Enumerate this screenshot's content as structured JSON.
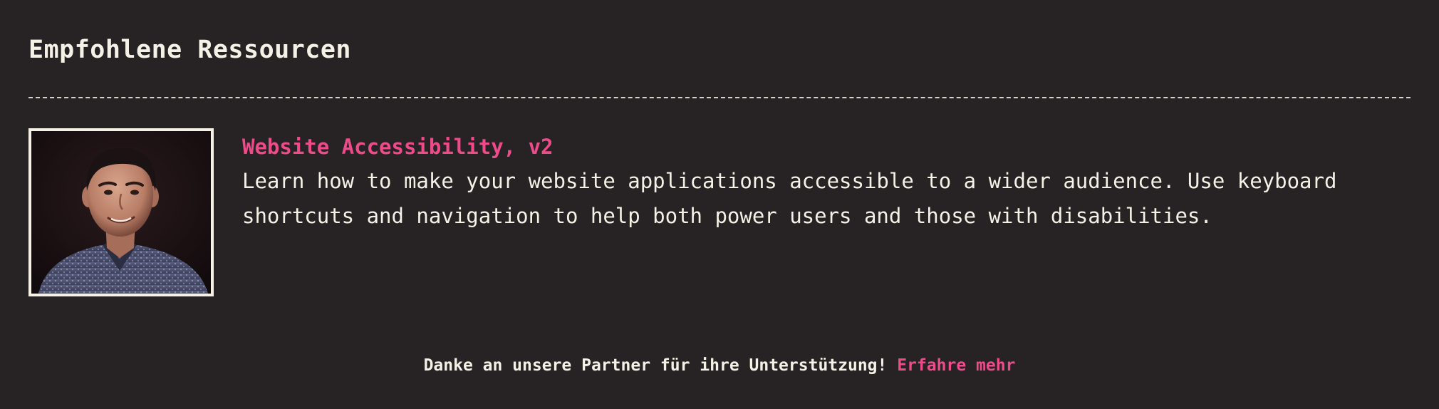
{
  "section": {
    "title": "Empfohlene Ressourcen"
  },
  "resource": {
    "title": "Website Accessibility, v2",
    "description": "Learn how to make your website applications accessible to a wider audience. Use keyboard shortcuts and navigation to help both power users and those with disabilities.",
    "image": "instructor-portrait"
  },
  "footer": {
    "thanks_text": "Danke an unsere Partner für ihre Unterstützung!",
    "link_text": "Erfahre mehr"
  },
  "colors": {
    "background": "#272325",
    "text": "#f5f1e6",
    "accent": "#ee4b8b"
  }
}
